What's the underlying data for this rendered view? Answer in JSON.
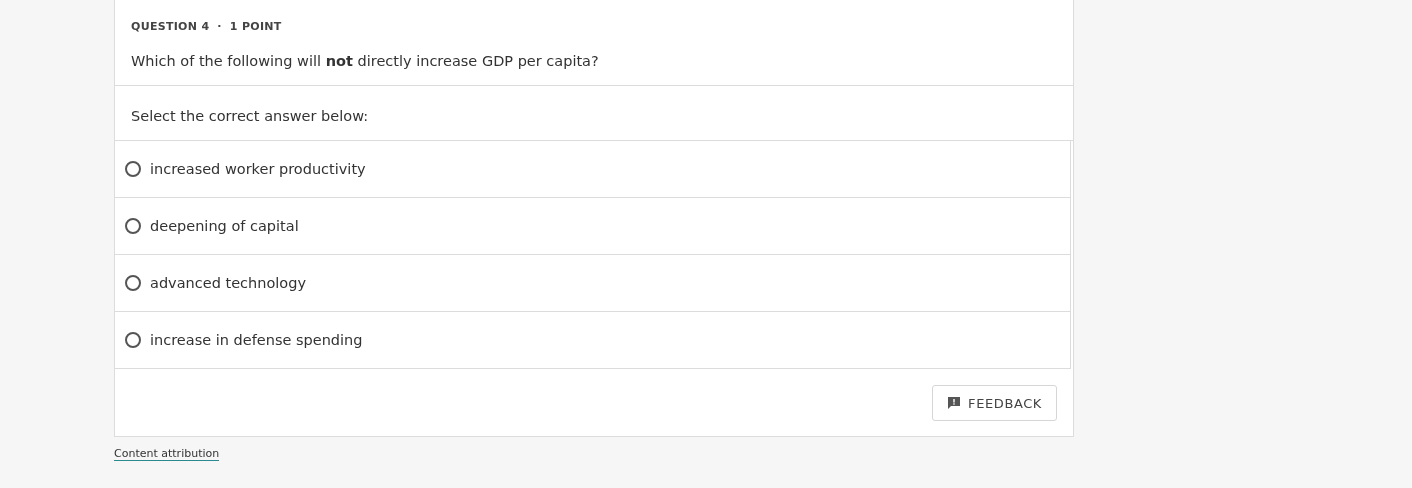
{
  "question": {
    "heading": "QUESTION 4",
    "separator": "·",
    "points": "1 POINT",
    "prompt": "Which of the following will **not** directly increase GDP per capita?"
  },
  "instruction": "Select the correct answer below:",
  "options": [
    {
      "label": "increased worker productivity",
      "selected": false
    },
    {
      "label": "deepening of capital",
      "selected": false
    },
    {
      "label": "advanced technology",
      "selected": false
    },
    {
      "label": "increase in defense spending",
      "selected": false
    }
  ],
  "feedback_button": "FEEDBACK",
  "attribution_link": "Content attribution"
}
